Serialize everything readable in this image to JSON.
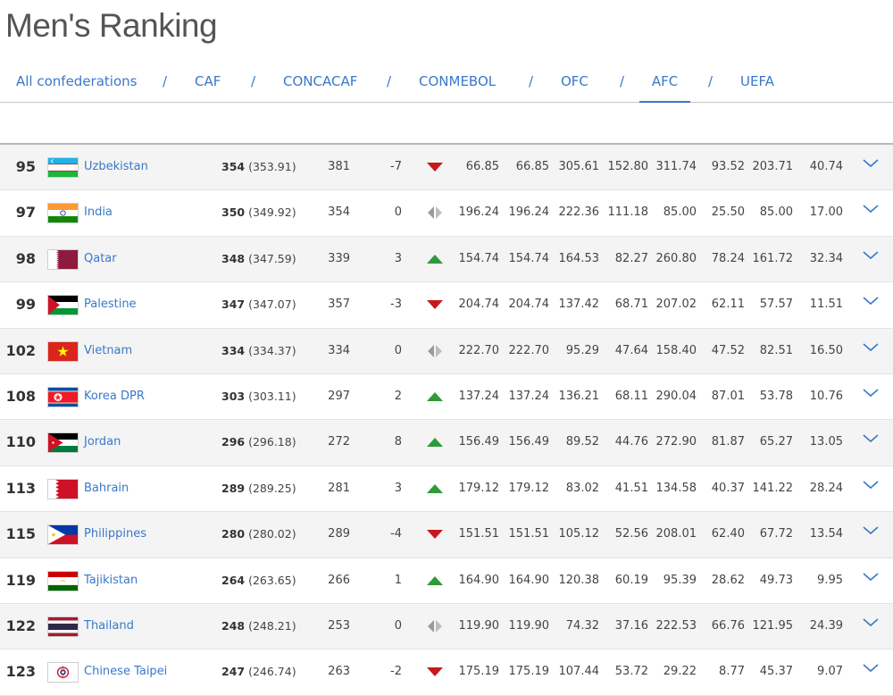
{
  "page": {
    "title": "Men's Ranking"
  },
  "tabs": [
    {
      "label": "All confederations",
      "active": false
    },
    {
      "label": "CAF",
      "active": false
    },
    {
      "label": "CONCACAF",
      "active": false
    },
    {
      "label": "CONMEBOL",
      "active": false
    },
    {
      "label": "OFC",
      "active": false
    },
    {
      "label": "AFC",
      "active": true
    },
    {
      "label": "UEFA",
      "active": false
    }
  ],
  "tab_separator": "/",
  "colors": {
    "accent": "#3a78c8",
    "up": "#2e9a3a",
    "down": "#c8181e",
    "same": "#9a9a9a"
  },
  "rows": [
    {
      "rank": "95",
      "team": "Uzbekistan",
      "flag": "uzbekistan-flag-icon",
      "points": "354",
      "points_precise": "(353.91)",
      "prev_points": "381",
      "movement": "-7",
      "trend": "down",
      "stats": [
        "66.85",
        "66.85",
        "305.61",
        "152.80",
        "311.74",
        "93.52",
        "203.71",
        "40.74"
      ]
    },
    {
      "rank": "97",
      "team": "India",
      "flag": "india-flag-icon",
      "points": "350",
      "points_precise": "(349.92)",
      "prev_points": "354",
      "movement": "0",
      "trend": "same",
      "stats": [
        "196.24",
        "196.24",
        "222.36",
        "111.18",
        "85.00",
        "25.50",
        "85.00",
        "17.00"
      ]
    },
    {
      "rank": "98",
      "team": "Qatar",
      "flag": "qatar-flag-icon",
      "points": "348",
      "points_precise": "(347.59)",
      "prev_points": "339",
      "movement": "3",
      "trend": "up",
      "stats": [
        "154.74",
        "154.74",
        "164.53",
        "82.27",
        "260.80",
        "78.24",
        "161.72",
        "32.34"
      ]
    },
    {
      "rank": "99",
      "team": "Palestine",
      "flag": "palestine-flag-icon",
      "points": "347",
      "points_precise": "(347.07)",
      "prev_points": "357",
      "movement": "-3",
      "trend": "down",
      "stats": [
        "204.74",
        "204.74",
        "137.42",
        "68.71",
        "207.02",
        "62.11",
        "57.57",
        "11.51"
      ]
    },
    {
      "rank": "102",
      "team": "Vietnam",
      "flag": "vietnam-flag-icon",
      "points": "334",
      "points_precise": "(334.37)",
      "prev_points": "334",
      "movement": "0",
      "trend": "same",
      "stats": [
        "222.70",
        "222.70",
        "95.29",
        "47.64",
        "158.40",
        "47.52",
        "82.51",
        "16.50"
      ]
    },
    {
      "rank": "108",
      "team": "Korea DPR",
      "flag": "korea-dpr-flag-icon",
      "points": "303",
      "points_precise": "(303.11)",
      "prev_points": "297",
      "movement": "2",
      "trend": "up",
      "stats": [
        "137.24",
        "137.24",
        "136.21",
        "68.11",
        "290.04",
        "87.01",
        "53.78",
        "10.76"
      ]
    },
    {
      "rank": "110",
      "team": "Jordan",
      "flag": "jordan-flag-icon",
      "points": "296",
      "points_precise": "(296.18)",
      "prev_points": "272",
      "movement": "8",
      "trend": "up",
      "stats": [
        "156.49",
        "156.49",
        "89.52",
        "44.76",
        "272.90",
        "81.87",
        "65.27",
        "13.05"
      ]
    },
    {
      "rank": "113",
      "team": "Bahrain",
      "flag": "bahrain-flag-icon",
      "points": "289",
      "points_precise": "(289.25)",
      "prev_points": "281",
      "movement": "3",
      "trend": "up",
      "stats": [
        "179.12",
        "179.12",
        "83.02",
        "41.51",
        "134.58",
        "40.37",
        "141.22",
        "28.24"
      ]
    },
    {
      "rank": "115",
      "team": "Philippines",
      "flag": "philippines-flag-icon",
      "points": "280",
      "points_precise": "(280.02)",
      "prev_points": "289",
      "movement": "-4",
      "trend": "down",
      "stats": [
        "151.51",
        "151.51",
        "105.12",
        "52.56",
        "208.01",
        "62.40",
        "67.72",
        "13.54"
      ]
    },
    {
      "rank": "119",
      "team": "Tajikistan",
      "flag": "tajikistan-flag-icon",
      "points": "264",
      "points_precise": "(263.65)",
      "prev_points": "266",
      "movement": "1",
      "trend": "up",
      "stats": [
        "164.90",
        "164.90",
        "120.38",
        "60.19",
        "95.39",
        "28.62",
        "49.73",
        "9.95"
      ]
    },
    {
      "rank": "122",
      "team": "Thailand",
      "flag": "thailand-flag-icon",
      "points": "248",
      "points_precise": "(248.21)",
      "prev_points": "253",
      "movement": "0",
      "trend": "same",
      "stats": [
        "119.90",
        "119.90",
        "74.32",
        "37.16",
        "222.53",
        "66.76",
        "121.95",
        "24.39"
      ]
    },
    {
      "rank": "123",
      "team": "Chinese Taipei",
      "flag": "chinese-taipei-flag-icon",
      "points": "247",
      "points_precise": "(246.74)",
      "prev_points": "263",
      "movement": "-2",
      "trend": "down",
      "stats": [
        "175.19",
        "175.19",
        "107.44",
        "53.72",
        "29.22",
        "8.77",
        "45.37",
        "9.07"
      ]
    }
  ]
}
